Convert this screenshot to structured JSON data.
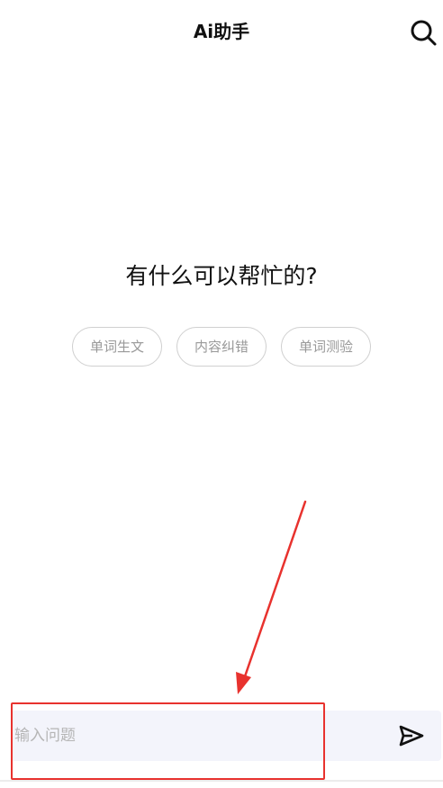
{
  "header": {
    "title": "Ai助手",
    "search_icon": "search-icon"
  },
  "main": {
    "welcome_text": "有什么可以帮忙的?",
    "suggestions": [
      {
        "label": "单词生文"
      },
      {
        "label": "内容纠错"
      },
      {
        "label": "单词测验"
      }
    ]
  },
  "composer": {
    "placeholder": "输入问题",
    "value": "",
    "send_icon": "send-icon"
  },
  "annotation": {
    "color": "#e8322e",
    "highlight": "input-bar",
    "arrow_icon": "red-arrow"
  }
}
